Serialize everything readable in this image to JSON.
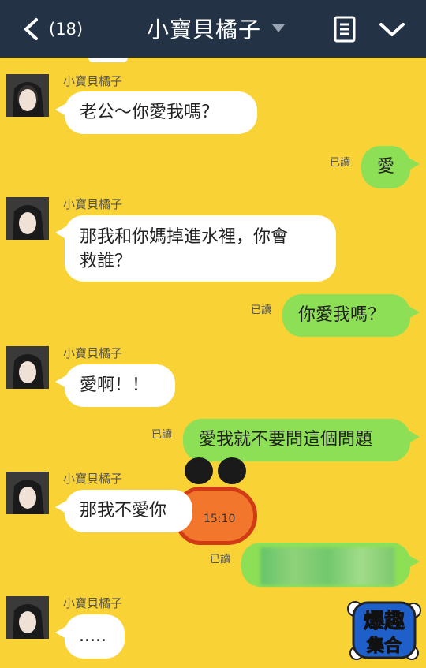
{
  "header": {
    "unread_count": "(18)",
    "title": "小寶貝橘子"
  },
  "messages": [
    {
      "from": "小寶貝橘子",
      "text": "老公～你愛我嗎？"
    },
    {
      "text": "愛",
      "status": "已讀"
    },
    {
      "from": "小寶貝橘子",
      "text": "那我和你媽掉進水裡，你會救誰？",
      "lines": [
        "那我和你媽掉進水裡，你會",
        "救誰？"
      ]
    },
    {
      "text": "你愛我嗎？",
      "status": "已讀"
    },
    {
      "from": "小寶貝橘子",
      "text": "愛啊！！"
    },
    {
      "text": "愛我就不要問這個問題",
      "status": "已讀"
    },
    {
      "from": "小寶貝橘子",
      "text": "那我不愛你",
      "sticker_time": "15:10"
    },
    {
      "text": "",
      "status": "已讀",
      "blurred": true
    },
    {
      "from": "小寶貝橘子",
      "text": "....."
    }
  ],
  "watermark": {
    "line1": "爆趣",
    "line2": "集合"
  },
  "colors": {
    "header_bg": "#233345",
    "chat_bg": "#f9d336",
    "outgoing_bubble": "#8de055",
    "incoming_bubble": "#ffffff"
  },
  "icons": [
    "back-chevron-icon",
    "title-dropdown-caret-icon",
    "menu-list-icon",
    "collapse-chevron-icon"
  ]
}
